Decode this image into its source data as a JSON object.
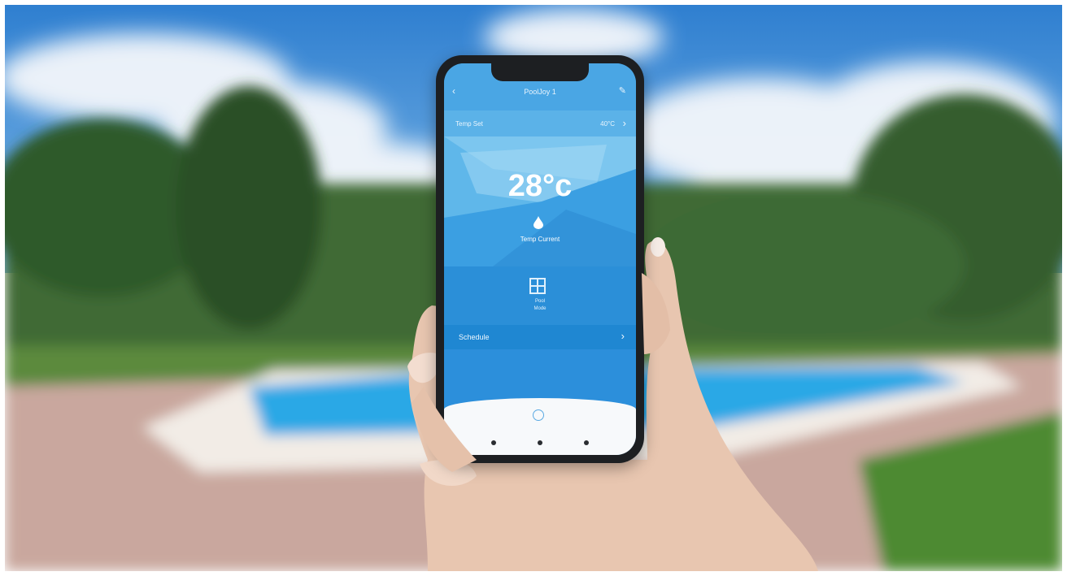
{
  "scene": {
    "description_icons": [
      "pool",
      "trees",
      "sky",
      "hand",
      "smartphone"
    ]
  },
  "app": {
    "title": "PoolJoy 1",
    "temp_set_label": "Temp Set",
    "temp_set_value": "40°C",
    "current_temp": "28°c",
    "current_label": "Temp Current",
    "mode_label": "Pool",
    "mode_sub": "Mode",
    "schedule_label": "Schedule"
  },
  "colors": {
    "accent": "#2f8fd6",
    "sky": "#3b8fd8",
    "pool": "#2aa8e6"
  }
}
